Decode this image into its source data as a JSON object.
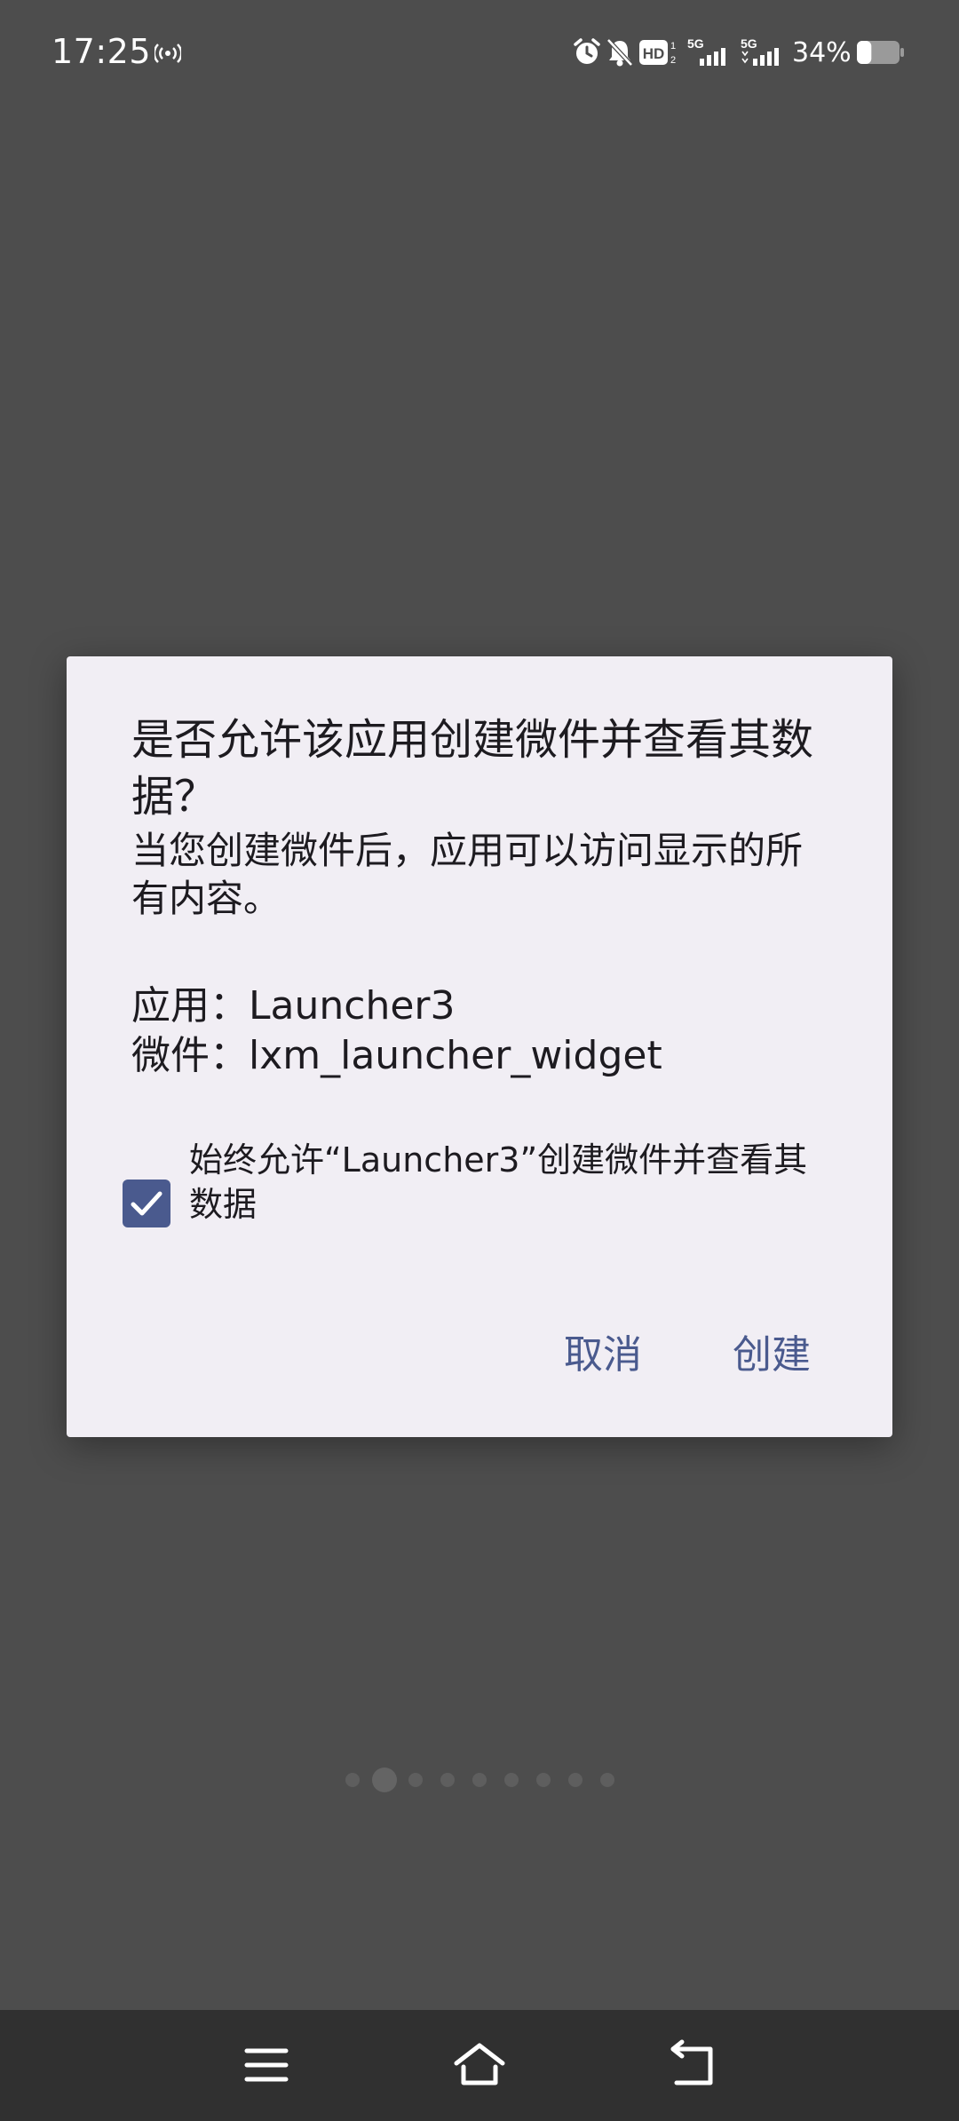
{
  "status_bar": {
    "time": "17:25",
    "battery_percent": "34%",
    "icons": [
      "hotspot-icon",
      "alarm-icon",
      "bell-off-icon",
      "hd-icon",
      "signal-5g-icon",
      "signal-5g-icon",
      "battery-icon"
    ],
    "hd_label": "HD",
    "network_label": "5G",
    "battery_level": 0.34
  },
  "dialog": {
    "title": "是否允许该应用创建微件并查看其数据？",
    "message": "当您创建微件后，应用可以访问显示的所有内容。",
    "app_line": "应用：Launcher3",
    "widget_line": "微件：lxm_launcher_widget",
    "checkbox_label": "始终允许“Launcher3”创建微件并查看其数据",
    "checkbox_checked": true,
    "cancel_label": "取消",
    "create_label": "创建",
    "accent_color": "#4a5a8e"
  },
  "page_indicator": {
    "count": 9,
    "active_index": 1
  },
  "nav_bar": {
    "buttons": [
      "menu-icon",
      "home-icon",
      "back-icon"
    ]
  }
}
